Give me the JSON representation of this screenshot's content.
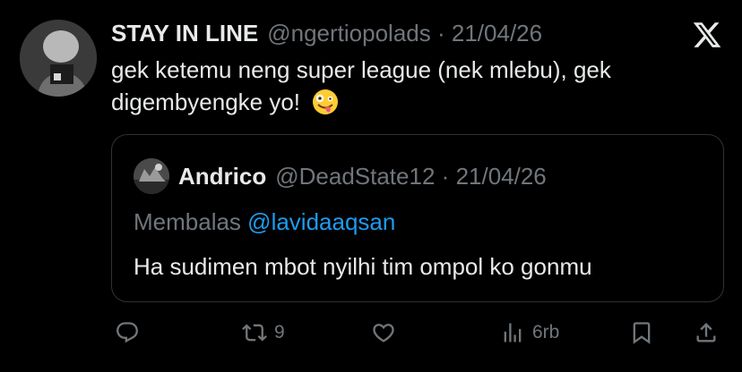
{
  "post": {
    "display_name": "STAY IN LINE",
    "handle": "@ngertiopolads",
    "separator": "·",
    "date": "21/04/26",
    "text": "gek ketemu neng super league (nek mlebu), gek digembyengke yo!",
    "emoji": "zany-face-emoji"
  },
  "brand": {
    "logo": "x-logo-icon"
  },
  "quote": {
    "display_name": "Andrico",
    "handle": "@DeadState12",
    "separator": "·",
    "date": "21/04/26",
    "reply_prefix": "Membalas",
    "reply_mention": "@lavidaaqsan",
    "text": "Ha sudimen mbot nyilhi tim ompol ko gonmu"
  },
  "actions": {
    "reply": {
      "icon": "reply-icon",
      "count": ""
    },
    "repost": {
      "icon": "repost-icon",
      "count": "9"
    },
    "like": {
      "icon": "heart-icon",
      "count": ""
    },
    "views": {
      "icon": "views-icon",
      "count": "6rb"
    },
    "bookmark": {
      "icon": "bookmark-icon",
      "count": ""
    },
    "share": {
      "icon": "share-icon",
      "count": ""
    }
  },
  "colors": {
    "background": "#000000",
    "text": "#e7e9ea",
    "secondary": "#71767b",
    "link": "#1d9bf0",
    "border": "#2f3336"
  }
}
